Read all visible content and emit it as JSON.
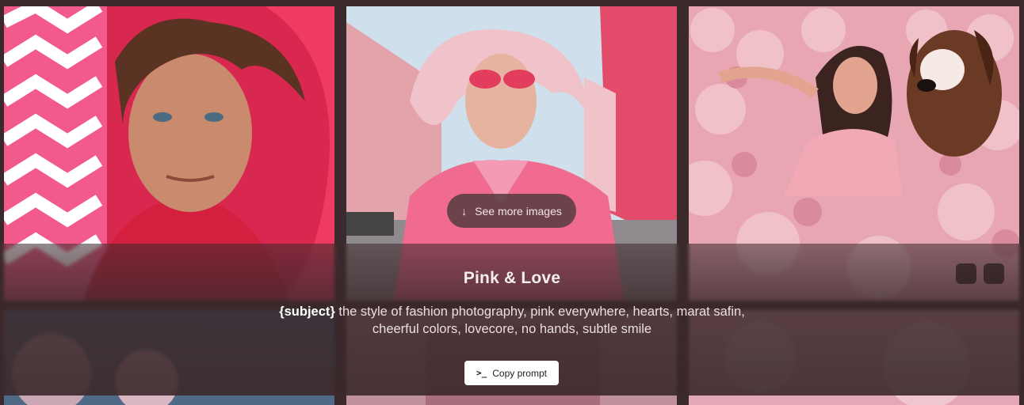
{
  "gallery": {
    "see_more_label": "See more images",
    "see_more_icon": "arrow-down-icon"
  },
  "style_card": {
    "title": "Pink & Love",
    "prompt_subject": "{subject}",
    "prompt_line1": " the style of fashion photography, pink everywhere, hearts, marat safin,",
    "prompt_line2": "cheerful colors, lovecore, no hands, subtle smile",
    "copy_label": "Copy prompt",
    "copy_icon": "terminal-icon"
  },
  "colors": {
    "background": "#3a2a2c",
    "accent_pink": "#e8527a"
  }
}
